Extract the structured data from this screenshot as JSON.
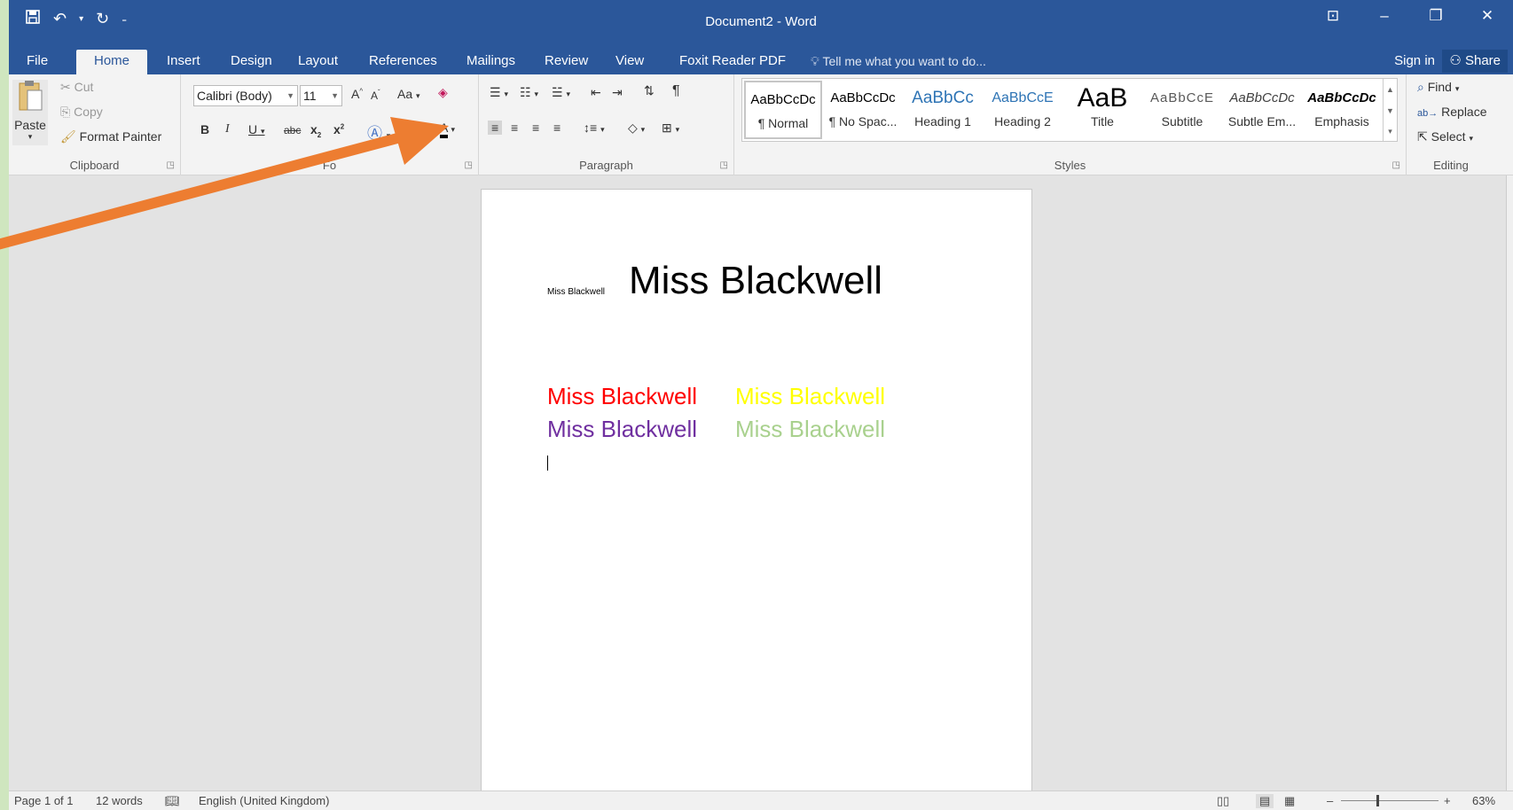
{
  "titlebar": {
    "title": "Document2 - Word",
    "qat": [
      "save-icon",
      "undo-icon",
      "redo-icon",
      "customize-icon"
    ]
  },
  "tabs": [
    "File",
    "Home",
    "Insert",
    "Design",
    "Layout",
    "References",
    "Mailings",
    "Review",
    "View",
    "Foxit Reader PDF"
  ],
  "active_tab": "Home",
  "tell_me": "Tell me what you want to do...",
  "sign_in": "Sign in",
  "share": "Share",
  "clipboard": {
    "paste": "Paste",
    "cut": "Cut",
    "copy": "Copy",
    "format_painter": "Format Painter",
    "label": "Clipboard"
  },
  "font": {
    "family": "Calibri (Body)",
    "size": "11",
    "grow": "A",
    "shrink": "A",
    "change_case": "Aa",
    "bold": "B",
    "italic": "I",
    "underline": "U",
    "strike": "abc",
    "subscript": "x",
    "superscript": "x",
    "label_visible": "Fo"
  },
  "paragraph": {
    "label": "Paragraph"
  },
  "styles": {
    "label": "Styles",
    "items": [
      {
        "sample": "AaBbCcDc",
        "name": "¶ Normal",
        "color": "#000000"
      },
      {
        "sample": "AaBbCcDc",
        "name": "¶ No Spac...",
        "color": "#000000"
      },
      {
        "sample": "AaBbCc",
        "name": "Heading 1",
        "color": "#2e74b5"
      },
      {
        "sample": "AaBbCcE",
        "name": "Heading 2",
        "color": "#2e74b5"
      },
      {
        "sample": "AaB",
        "name": "Title",
        "color": "#000000"
      },
      {
        "sample": "AaBbCcE",
        "name": "Subtitle",
        "color": "#595959"
      },
      {
        "sample": "AaBbCcDc",
        "name": "Subtle Em...",
        "color": "#404040"
      },
      {
        "sample": "AaBbCcDc",
        "name": "Emphasis",
        "color": "#000000"
      }
    ]
  },
  "editing": {
    "find": "Find",
    "replace": "Replace",
    "select": "Select",
    "label": "Editing"
  },
  "document": {
    "small_text": "Miss Blackwell",
    "big_text": "Miss Blackwell",
    "colored_lines": [
      {
        "text": "Miss Blackwell",
        "color": "#ff0000"
      },
      {
        "text": "Miss Blackwell",
        "color": "#ffff00"
      },
      {
        "text": "Miss Blackwell",
        "color": "#7030a0"
      },
      {
        "text": "Miss Blackwell",
        "color": "#a9d18e"
      }
    ]
  },
  "status": {
    "page": "Page 1 of 1",
    "words": "12 words",
    "language": "English (United Kingdom)",
    "zoom": "63%"
  },
  "annotation": {
    "arrow_color": "#ed7d31"
  }
}
